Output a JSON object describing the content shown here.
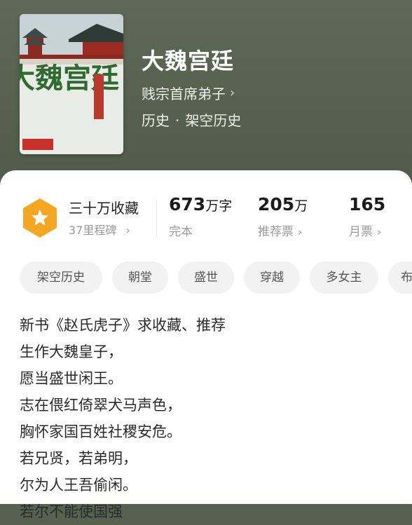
{
  "book": {
    "title": "大魏宫廷",
    "author": "贱宗首席弟子",
    "genre_main": "历史",
    "genre_sub": "架空历史",
    "cover_title": "大魏宫廷"
  },
  "stats": {
    "honor_title": "三十万收藏",
    "honor_sub": "37里程碑",
    "words_num": "673",
    "words_unit": "万字",
    "words_sub": "完本",
    "recommend_num": "205",
    "recommend_unit": "万",
    "recommend_sub": "推荐票",
    "monthly_num": "165",
    "monthly_sub": "月票"
  },
  "tags": [
    "架空历史",
    "朝堂",
    "盛世",
    "穿越",
    "多女主",
    "布"
  ],
  "intro": [
    "新书《赵氏虎子》求收藏、推荐",
    "生作大魏皇子，",
    "愿当盛世闲王。",
    "志在偎红倚翠犬马声色，",
    "胸怀家国百姓社稷安危。",
    "若兄贤，若弟明，",
    "尔为人王吾偷闲。",
    "若尔不能使国强"
  ],
  "colors": {
    "hero_bg": "#56614f",
    "badge": "#f5a623"
  }
}
